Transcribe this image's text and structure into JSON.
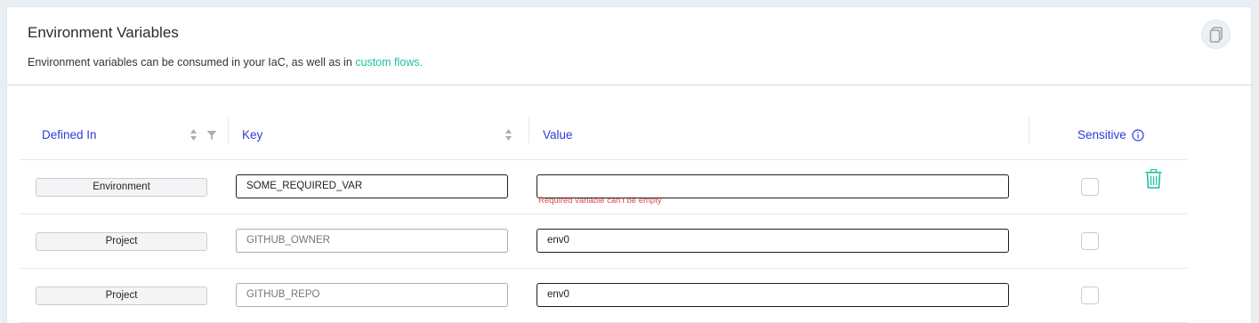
{
  "header": {
    "title": "Environment Variables",
    "subtitle_text": "Environment variables can be consumed in your IaC, as well as in",
    "subtitle_link": "custom flows."
  },
  "table": {
    "columns": {
      "defined_in": "Defined In",
      "key": "Key",
      "value": "Value",
      "sensitive": "Sensitive"
    },
    "rows": [
      {
        "defined_in": "Environment",
        "key": "SOME_REQUIRED_VAR",
        "value": "",
        "error": "Required variable can't be empty",
        "sensitive": false
      },
      {
        "defined_in": "Project",
        "key": "GITHUB_OWNER",
        "value": "env0",
        "sensitive": false
      },
      {
        "defined_in": "Project",
        "key": "GITHUB_REPO",
        "value": "env0",
        "sensitive": false
      }
    ]
  },
  "colors": {
    "header_text": "#2d3bd6",
    "link": "#1cc29f",
    "error": "#e04848",
    "trash": "#1cc29f"
  },
  "icons": {
    "copy": "copy-icon",
    "sort": "sort-icon",
    "filter": "filter-icon",
    "info": "info-icon",
    "delete": "trash-icon"
  }
}
